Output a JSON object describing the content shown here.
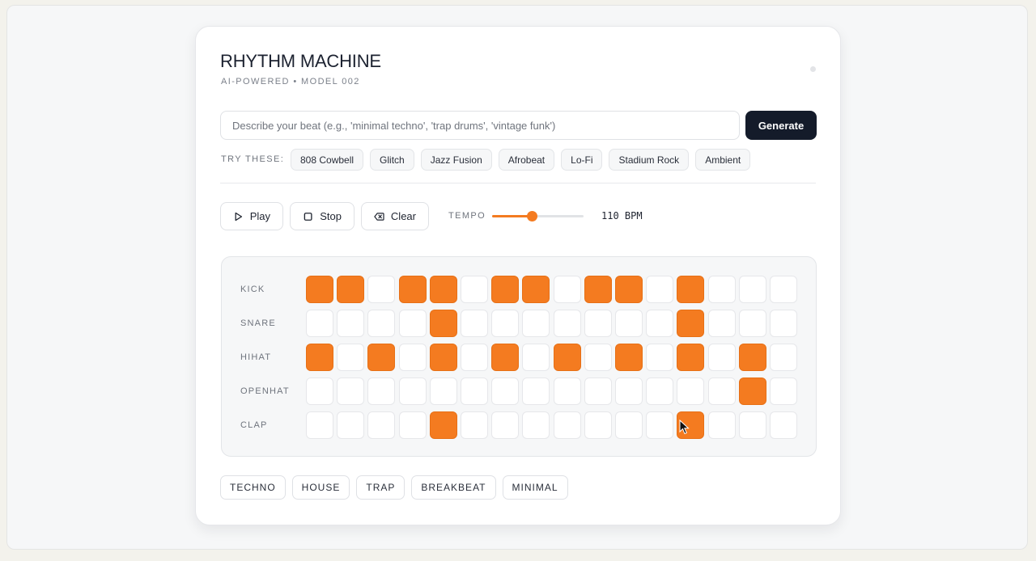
{
  "header": {
    "title": "RHYTHM MACHINE",
    "subtitle": "AI-POWERED • MODEL 002"
  },
  "prompt": {
    "placeholder": "Describe your beat (e.g., 'minimal techno', 'trap drums', 'vintage funk')",
    "value": "",
    "generate_label": "Generate"
  },
  "suggestions": {
    "label": "TRY THESE:",
    "items": [
      "808 Cowbell",
      "Glitch",
      "Jazz Fusion",
      "Afrobeat",
      "Lo-Fi",
      "Stadium Rock",
      "Ambient"
    ]
  },
  "transport": {
    "play_label": "Play",
    "stop_label": "Stop",
    "clear_label": "Clear",
    "tempo_label": "TEMPO",
    "tempo_value_text": "110 BPM",
    "tempo_slider_fraction": 0.43
  },
  "sequencer": {
    "tracks": [
      {
        "name": "KICK",
        "steps": [
          1,
          1,
          0,
          1,
          1,
          0,
          1,
          1,
          0,
          1,
          1,
          0,
          1,
          0,
          0,
          0
        ]
      },
      {
        "name": "SNARE",
        "steps": [
          0,
          0,
          0,
          0,
          1,
          0,
          0,
          0,
          0,
          0,
          0,
          0,
          1,
          0,
          0,
          0
        ]
      },
      {
        "name": "HIHAT",
        "steps": [
          1,
          0,
          1,
          0,
          1,
          0,
          1,
          0,
          1,
          0,
          1,
          0,
          1,
          0,
          1,
          0
        ]
      },
      {
        "name": "OPENHAT",
        "steps": [
          0,
          0,
          0,
          0,
          0,
          0,
          0,
          0,
          0,
          0,
          0,
          0,
          0,
          0,
          1,
          0
        ]
      },
      {
        "name": "CLAP",
        "steps": [
          0,
          0,
          0,
          0,
          1,
          0,
          0,
          0,
          0,
          0,
          0,
          0,
          1,
          0,
          0,
          0
        ]
      }
    ]
  },
  "presets": [
    "TECHNO",
    "HOUSE",
    "TRAP",
    "BREAKBEAT",
    "MINIMAL"
  ],
  "colors": {
    "accent": "#f47b20",
    "dark_button": "#141b2a"
  },
  "icons": {
    "play": "play-icon",
    "stop": "stop-icon",
    "clear": "backspace-icon",
    "cursor": "mouse-pointer-icon"
  }
}
